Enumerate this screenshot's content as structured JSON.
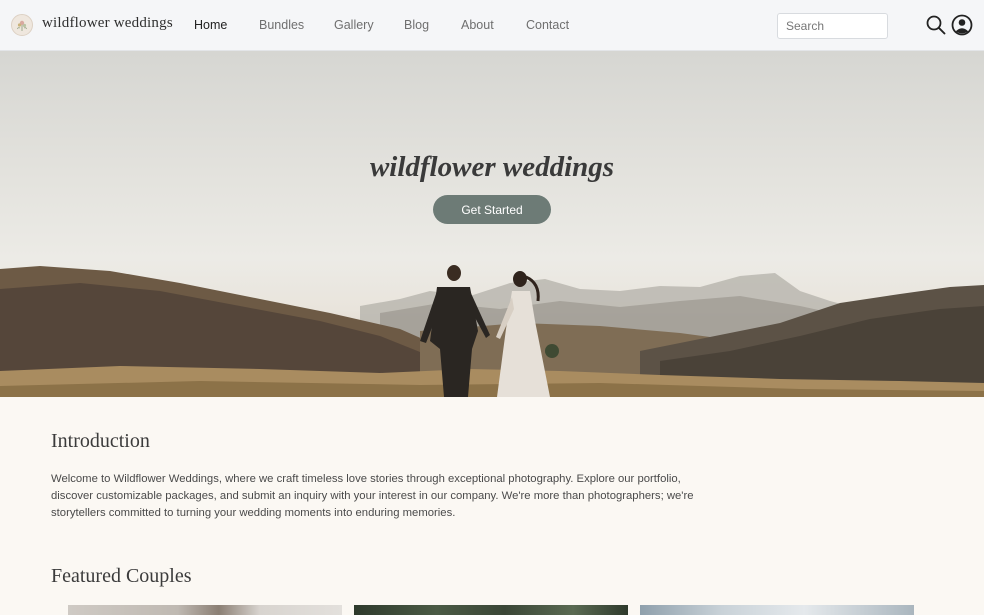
{
  "nav": {
    "brand": "wildflower weddings",
    "links": [
      "Home",
      "Bundles",
      "Gallery",
      "Blog",
      "About",
      "Contact"
    ],
    "active": "Home",
    "search_placeholder": "Search",
    "icons": [
      "search-icon",
      "account-icon"
    ]
  },
  "hero": {
    "title": "wildflower weddings",
    "cta_label": "Get Started"
  },
  "intro": {
    "heading": "Introduction",
    "body": "Welcome to Wildflower Weddings, where we craft timeless love stories through exceptional photography. Explore our portfolio, discover customizable packages, and submit an inquiry with your interest in our company. We're more than photographers; we're storytellers committed to turning your wedding moments into enduring memories."
  },
  "featured": {
    "heading": "Featured Couples"
  },
  "colors": {
    "nav_bg": "#f5f6f8",
    "page_bg": "#fbf8f3",
    "cta_bg": "#6d7b76"
  }
}
